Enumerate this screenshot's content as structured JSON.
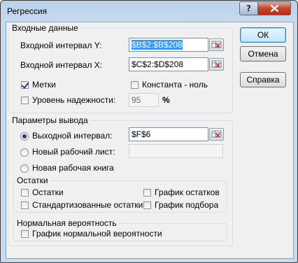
{
  "window": {
    "title": "Регрессия",
    "help_icon": "?",
    "close_icon": "x"
  },
  "input": {
    "group_label": "Входные данные",
    "y_label": "Входной интервал Y:",
    "y_value": "$B$2:$B$208",
    "x_label": "Входной интервал X:",
    "x_value": "$C$2:$D$208",
    "labels_label": "Метки",
    "labels_checked": true,
    "constant_label": "Константа - ноль",
    "constant_checked": false,
    "confidence_label": "Уровень надежности:",
    "confidence_checked": false,
    "confidence_value": "95",
    "percent": "%"
  },
  "output": {
    "group_label": "Параметры вывода",
    "output_range_label": "Выходной интервал:",
    "output_range_value": "$F$6",
    "new_sheet_label": "Новый рабочий лист:",
    "new_sheet_value": "",
    "new_book_label": "Новая рабочая книга",
    "selected": "output_range"
  },
  "residuals": {
    "group_label": "Остатки",
    "residuals_label": "Остатки",
    "std_residuals_label": "Стандартизованные остатки",
    "residual_plots_label": "График остатков",
    "line_fit_label": "График подбора"
  },
  "normal": {
    "group_label": "Нормальная вероятность",
    "plot_label": "График нормальной вероятности"
  },
  "buttons": {
    "ok": "ОК",
    "cancel": "Отмена",
    "help": "Справка"
  }
}
